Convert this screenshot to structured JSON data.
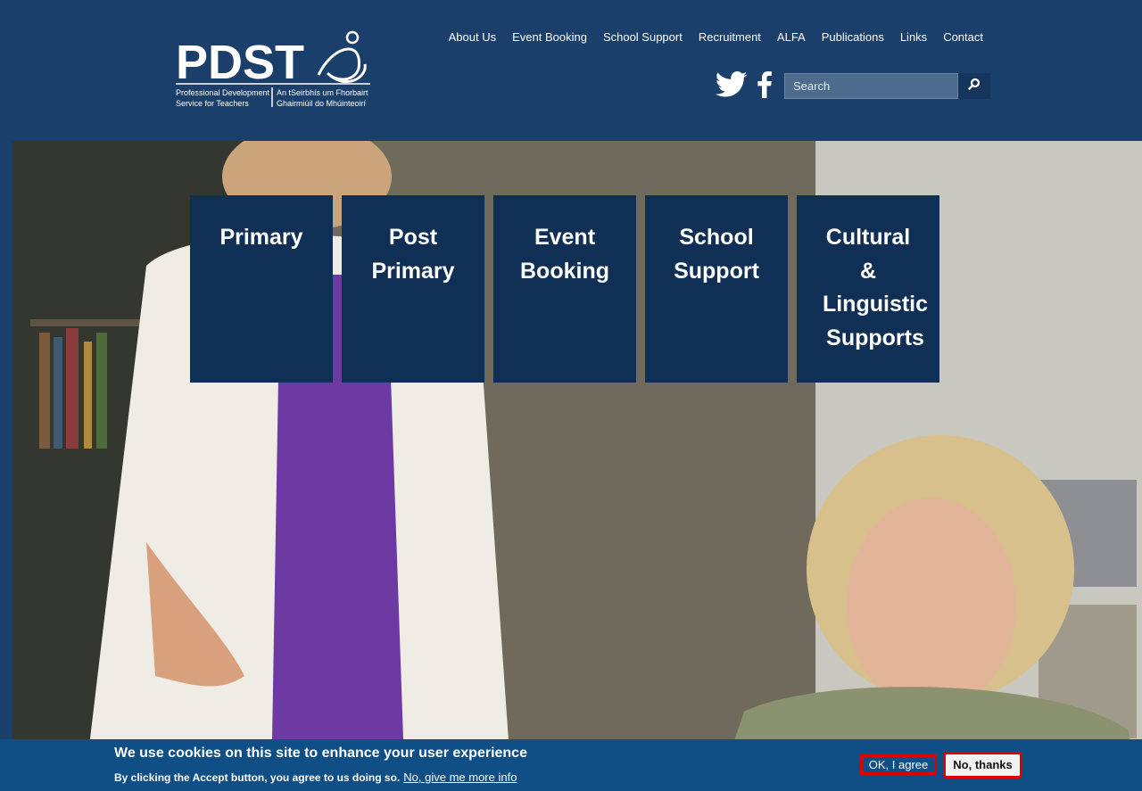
{
  "header": {
    "logo_text": "PDST",
    "logo_sub_en_1": "Professional Development",
    "logo_sub_en_2": "Service for Teachers",
    "logo_sub_ga_1": "An tSeirbhís um Fhorbairt",
    "logo_sub_ga_2": "Ghairmiúil do Mhúinteoirí",
    "nav": [
      "About Us",
      "Event Booking",
      "School Support",
      "Recruitment",
      "ALFA",
      "Publications",
      "Links",
      "Contact"
    ],
    "search_placeholder": "Search",
    "social_icons": [
      "twitter-icon",
      "facebook-icon"
    ],
    "search_icon": "search-icon"
  },
  "tiles": [
    {
      "lines": [
        "Primary"
      ]
    },
    {
      "lines": [
        "Post",
        "Primary"
      ]
    },
    {
      "lines": [
        "Event",
        "Booking"
      ]
    },
    {
      "lines": [
        "School",
        "Support"
      ]
    },
    {
      "lines": [
        "Cultural",
        "&",
        "Linguistic",
        "Supports"
      ]
    }
  ],
  "cookie": {
    "title": "We use cookies on this site to enhance your user experience",
    "text": "By clicking the Accept button, you agree to us doing so.",
    "more_info": "No, give me more info",
    "agree": "OK, I agree",
    "decline": "No, thanks"
  },
  "colors": {
    "header_bg": "#1b3f6b",
    "tile_bg": "#0f2f55",
    "cookie_bg": "#0f4f86",
    "highlight": "#e00000"
  }
}
